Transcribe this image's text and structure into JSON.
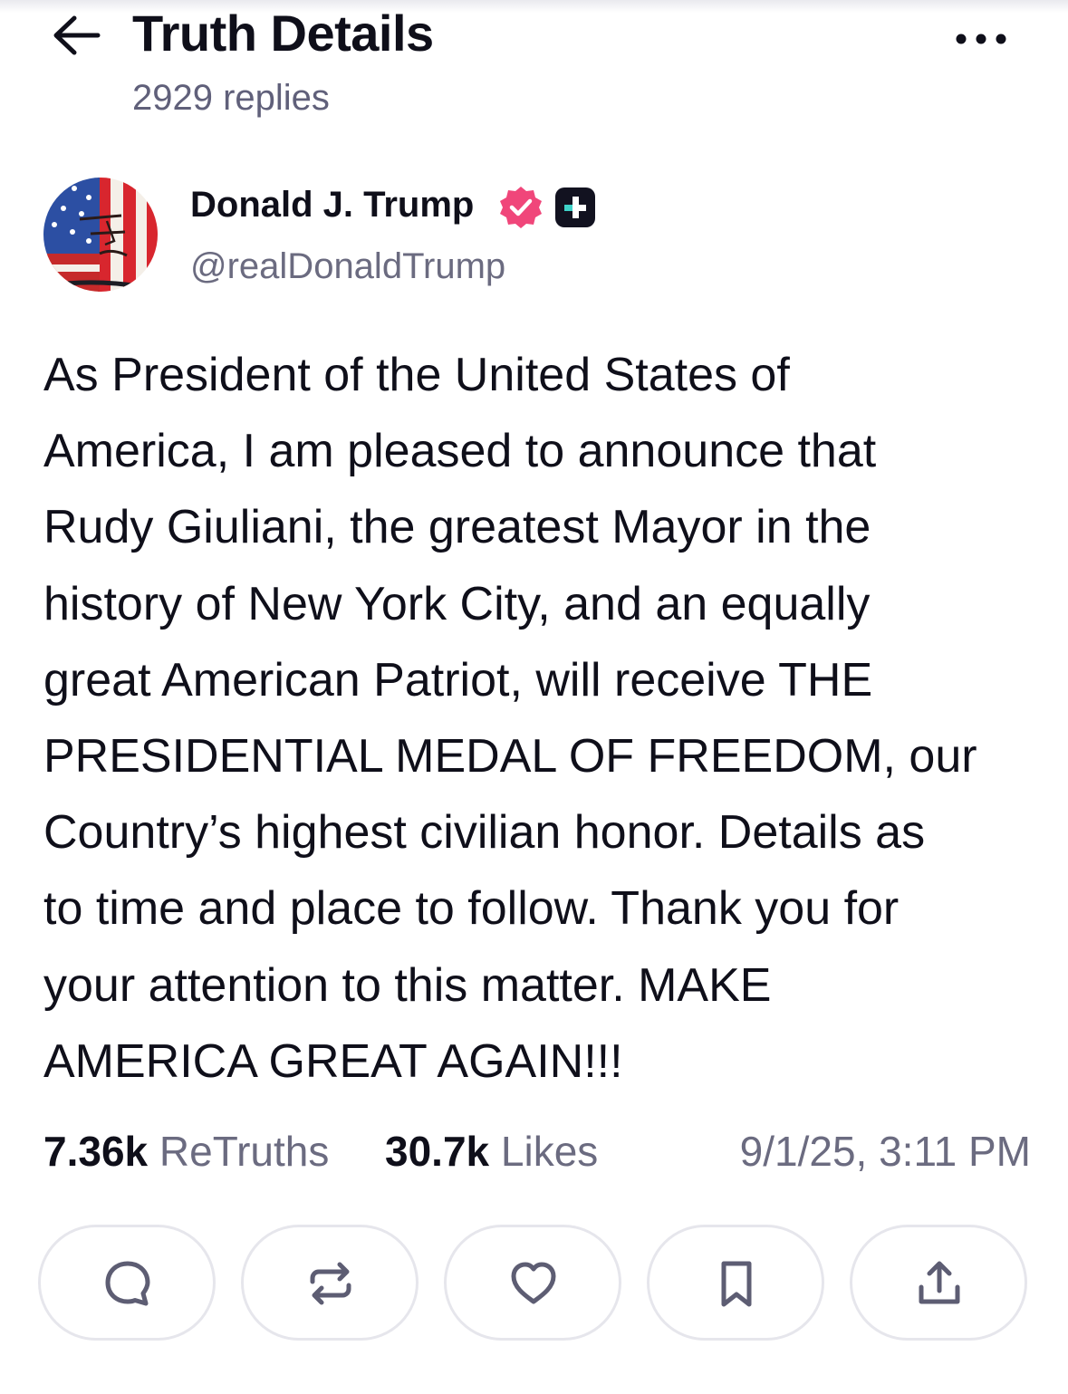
{
  "header": {
    "title": "Truth Details",
    "replies": "2929 replies",
    "back_icon": "arrow-left-icon",
    "more_icon": "more-horizontal-icon"
  },
  "author": {
    "name": "Donald J. Trump",
    "handle": "@realDonaldTrump",
    "verified_icon": "verified-badge-icon",
    "plus_icon": "truth-plus-badge-icon",
    "verified_color": "#f0467a"
  },
  "post": {
    "text": "As President of the United States of\nAmerica, I am pleased to announce that\nRudy Giuliani, the greatest Mayor in the\nhistory of New York City, and an equally\ngreat American Patriot, will receive THE\nPRESIDENTIAL MEDAL OF FREEDOM, our\nCountry’s highest civilian honor. Details as\nto time and place to follow. Thank you for\nyour attention to this matter.  MAKE\nAMERICA GREAT AGAIN!!!"
  },
  "stats": {
    "retruths_count": "7.36k",
    "retruths_label": "ReTruths",
    "likes_count": "30.7k",
    "likes_label": "Likes",
    "timestamp": "9/1/25, 3:11 PM"
  },
  "actions": [
    {
      "icon": "reply-icon"
    },
    {
      "icon": "retruth-icon"
    },
    {
      "icon": "heart-icon"
    },
    {
      "icon": "bookmark-icon"
    },
    {
      "icon": "share-icon"
    }
  ],
  "colors": {
    "text": "#0f0f1a",
    "muted": "#6b6b80",
    "icon": "#5d5d73",
    "border": "#e6e6ec"
  }
}
